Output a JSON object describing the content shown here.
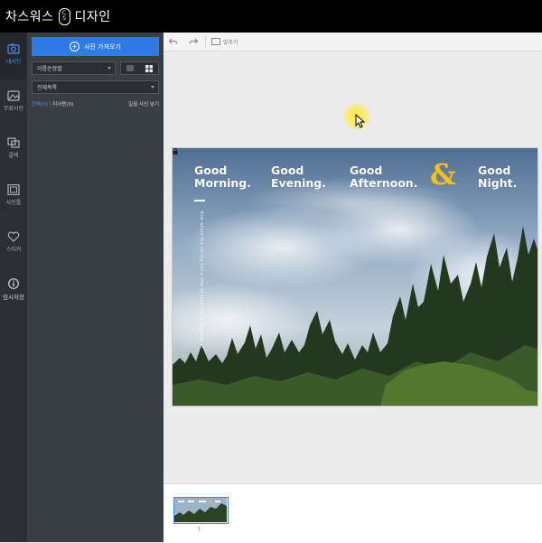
{
  "app": {
    "title_left": "차스워스",
    "logo_glyph_top": "C",
    "logo_glyph_bottom": "S",
    "title_right": "디자인"
  },
  "rail": {
    "items": [
      {
        "label": "내사진",
        "icon": "photo-icon",
        "active": true
      },
      {
        "label": "무료사진",
        "icon": "free-photo-icon",
        "active": false
      },
      {
        "label": "콜렉",
        "icon": "collection-icon",
        "active": false
      },
      {
        "label": "사진틀",
        "icon": "frame-icon",
        "active": false
      },
      {
        "label": "스티커",
        "icon": "heart-icon",
        "active": false
      },
      {
        "label": "임시저장",
        "icon": "info-icon",
        "active": false
      }
    ]
  },
  "panel": {
    "import_button": "사진 가져오기",
    "sort_select": "이름순정렬",
    "folder_select": "전체목록",
    "filter_all": "전체(0)",
    "filter_unused": "미사용(0)",
    "auto_place": "일괄 사진 넣기"
  },
  "toolbar": {
    "fit_label": "맞추기"
  },
  "design": {
    "greeting1": [
      "Good",
      "Morning."
    ],
    "greeting2": [
      "Good",
      "Evening."
    ],
    "greeting3": [
      "Good",
      "Afternoon."
    ],
    "ampersand": "&",
    "greeting4": [
      "Good",
      "Night."
    ],
    "vertical_text": "Raw whole the rolling hat a stay of time and a long way of",
    "accent_color": "#f2c21b"
  },
  "filmstrip": {
    "page_number": "1"
  }
}
